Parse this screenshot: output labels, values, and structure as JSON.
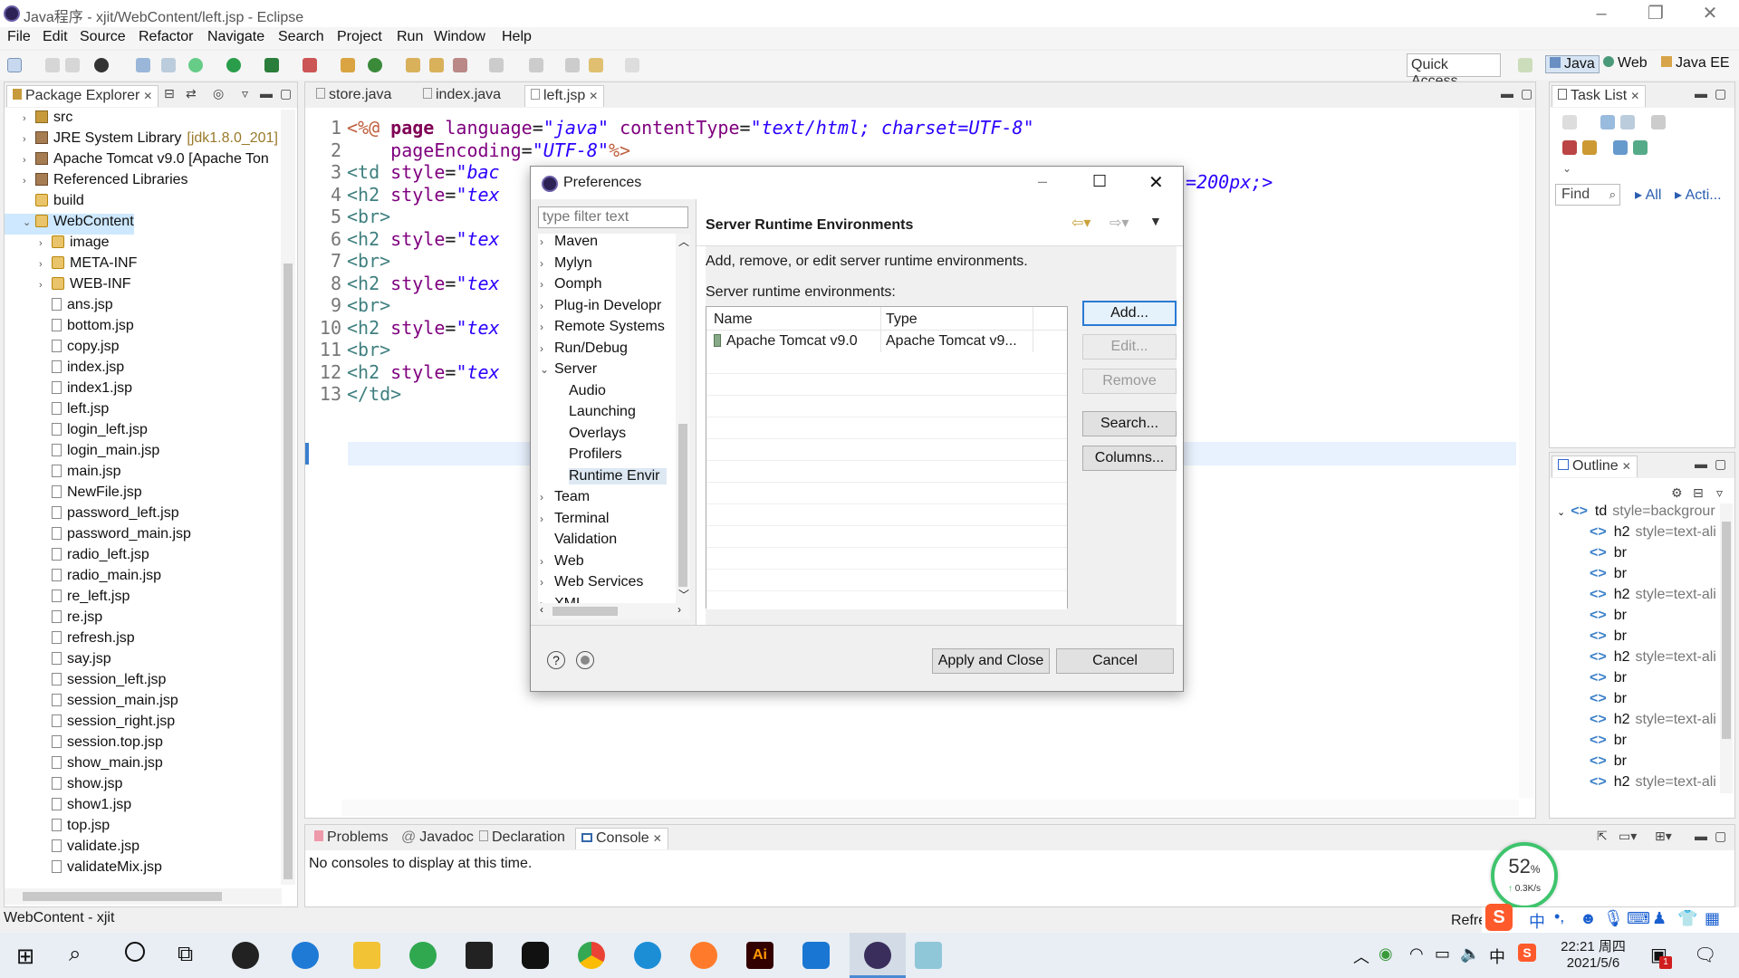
{
  "window": {
    "title": "Java程序 - xjit/WebContent/left.jsp - Eclipse"
  },
  "menu": [
    "File",
    "Edit",
    "Source",
    "Refactor",
    "Navigate",
    "Search",
    "Project",
    "Run",
    "Window",
    "Help"
  ],
  "toolbar": {
    "quick_access": "Quick Access",
    "perspectives": [
      "Java",
      "Web",
      "Java EE"
    ]
  },
  "explorer": {
    "tab": "Package Explorer",
    "items": [
      {
        "label": "src",
        "type": "pkg",
        "indent": 1,
        "arrow": "›"
      },
      {
        "label": "JRE System Library",
        "extra": "[jdk1.8.0_201]",
        "type": "lib",
        "indent": 1,
        "arrow": "›"
      },
      {
        "label": "Apache Tomcat v9.0 [Apache Ton",
        "type": "lib",
        "indent": 1,
        "arrow": "›"
      },
      {
        "label": "Referenced Libraries",
        "type": "lib",
        "indent": 1,
        "arrow": "›"
      },
      {
        "label": "build",
        "type": "folder",
        "indent": 1,
        "arrow": ""
      },
      {
        "label": "WebContent",
        "type": "folder",
        "indent": 1,
        "arrow": "⌄",
        "selected": true
      },
      {
        "label": "image",
        "type": "folder",
        "indent": 2,
        "arrow": "›"
      },
      {
        "label": "META-INF",
        "type": "folder",
        "indent": 2,
        "arrow": "›"
      },
      {
        "label": "WEB-INF",
        "type": "folder",
        "indent": 2,
        "arrow": "›"
      },
      {
        "label": "ans.jsp",
        "type": "file",
        "indent": 2
      },
      {
        "label": "bottom.jsp",
        "type": "file",
        "indent": 2
      },
      {
        "label": "copy.jsp",
        "type": "file",
        "indent": 2
      },
      {
        "label": "index.jsp",
        "type": "file",
        "indent": 2
      },
      {
        "label": "index1.jsp",
        "type": "file",
        "indent": 2
      },
      {
        "label": "left.jsp",
        "type": "file",
        "indent": 2
      },
      {
        "label": "login_left.jsp",
        "type": "file",
        "indent": 2
      },
      {
        "label": "login_main.jsp",
        "type": "file",
        "indent": 2
      },
      {
        "label": "main.jsp",
        "type": "file",
        "indent": 2
      },
      {
        "label": "NewFile.jsp",
        "type": "file",
        "indent": 2
      },
      {
        "label": "password_left.jsp",
        "type": "file",
        "indent": 2
      },
      {
        "label": "password_main.jsp",
        "type": "file",
        "indent": 2
      },
      {
        "label": "radio_left.jsp",
        "type": "file",
        "indent": 2
      },
      {
        "label": "radio_main.jsp",
        "type": "file",
        "indent": 2
      },
      {
        "label": "re_left.jsp",
        "type": "file",
        "indent": 2
      },
      {
        "label": "re.jsp",
        "type": "file",
        "indent": 2
      },
      {
        "label": "refresh.jsp",
        "type": "file",
        "indent": 2
      },
      {
        "label": "say.jsp",
        "type": "file",
        "indent": 2
      },
      {
        "label": "session_left.jsp",
        "type": "file",
        "indent": 2
      },
      {
        "label": "session_main.jsp",
        "type": "file",
        "indent": 2
      },
      {
        "label": "session_right.jsp",
        "type": "file",
        "indent": 2
      },
      {
        "label": "session.top.jsp",
        "type": "file",
        "indent": 2
      },
      {
        "label": "show_main.jsp",
        "type": "file",
        "indent": 2
      },
      {
        "label": "show.jsp",
        "type": "file",
        "indent": 2
      },
      {
        "label": "show1.jsp",
        "type": "file",
        "indent": 2
      },
      {
        "label": "top.jsp",
        "type": "file",
        "indent": 2
      },
      {
        "label": "validate.jsp",
        "type": "file",
        "indent": 2
      },
      {
        "label": "validateMix.jsp",
        "type": "file",
        "indent": 2
      }
    ]
  },
  "editor": {
    "tabs": [
      "store.java",
      "index.java",
      "left.jsp"
    ],
    "active_tab": "left.jsp",
    "lines": [
      {
        "n": "1",
        "html": "<span class='jsp'>&lt;%@</span> <span class='kw'>page</span> <span class='attr'>language</span>=<span class='str'>\"java\"</span> <span class='attr'>contentType</span>=<span class='str'>\"text/html; charset=UTF-8\"</span>"
      },
      {
        "n": "2",
        "html": "    <span class='attr'>pageEncoding</span>=<span class='str'>\"UTF-8\"</span><span class='jsp'>%&gt;</span>"
      },
      {
        "n": "3",
        "html": "<span class='tag'>&lt;td</span> <span class='attr'>style</span>=<span class='str'>\"bac</span>"
      },
      {
        "n": "4",
        "html": "<span class='tag'>&lt;h2</span> <span class='attr'>style</span>=<span class='str'>\"tex</span>"
      },
      {
        "n": "5",
        "html": "<span class='tag'>&lt;br&gt;</span>"
      },
      {
        "n": "6",
        "html": "<span class='tag'>&lt;h2</span> <span class='attr'>style</span>=<span class='str'>\"tex</span>"
      },
      {
        "n": "7",
        "html": "<span class='tag'>&lt;br&gt;</span>"
      },
      {
        "n": "8",
        "html": "<span class='tag'>&lt;h2</span> <span class='attr'>style</span>=<span class='str'>\"tex</span>"
      },
      {
        "n": "9",
        "html": "<span class='tag'>&lt;br&gt;</span>"
      },
      {
        "n": "10",
        "html": "<span class='tag'>&lt;h2</span> <span class='attr'>style</span>=<span class='str'>\"tex</span>"
      },
      {
        "n": "11",
        "html": "<span class='tag'>&lt;br&gt;</span>"
      },
      {
        "n": "12",
        "html": "<span class='tag'>&lt;h2</span> <span class='attr'>style</span>=<span class='str'>\"tex</span>"
      },
      {
        "n": "13",
        "html": "<span class='tag'>&lt;/td&gt;</span>"
      }
    ],
    "line3_tail": "=200px;>"
  },
  "tasklist": {
    "tab": "Task List",
    "find_placeholder": "Find",
    "all": "All",
    "acti": "Acti..."
  },
  "outline": {
    "tab": "Outline",
    "items": [
      {
        "label": "td",
        "extra": "style=backgrour",
        "root": true
      },
      {
        "label": "h2",
        "extra": "style=text-ali"
      },
      {
        "label": "br"
      },
      {
        "label": "br"
      },
      {
        "label": "h2",
        "extra": "style=text-ali"
      },
      {
        "label": "br"
      },
      {
        "label": "br"
      },
      {
        "label": "h2",
        "extra": "style=text-ali"
      },
      {
        "label": "br"
      },
      {
        "label": "br"
      },
      {
        "label": "h2",
        "extra": "style=text-ali"
      },
      {
        "label": "br"
      },
      {
        "label": "br"
      },
      {
        "label": "h2",
        "extra": "style=text-ali"
      }
    ]
  },
  "console": {
    "tabs": [
      "Problems",
      "Javadoc",
      "Declaration",
      "Console"
    ],
    "active_tab": "Console",
    "message": "No consoles to display at this time."
  },
  "status": {
    "left": "WebContent - xjit",
    "refresh": "Refre"
  },
  "net_widget": {
    "percent": "52",
    "unit": "%",
    "speed": "0.3K/s"
  },
  "dialog": {
    "title": "Preferences",
    "filter_placeholder": "type filter text",
    "tree": [
      {
        "label": "Maven",
        "arrow": "›",
        "indent": 0
      },
      {
        "label": "Mylyn",
        "arrow": "›",
        "indent": 0
      },
      {
        "label": "Oomph",
        "arrow": "›",
        "indent": 0
      },
      {
        "label": "Plug-in Developr",
        "arrow": "›",
        "indent": 0
      },
      {
        "label": "Remote Systems",
        "arrow": "›",
        "indent": 0
      },
      {
        "label": "Run/Debug",
        "arrow": "›",
        "indent": 0
      },
      {
        "label": "Server",
        "arrow": "⌄",
        "indent": 0
      },
      {
        "label": "Audio",
        "indent": 1
      },
      {
        "label": "Launching",
        "indent": 1
      },
      {
        "label": "Overlays",
        "indent": 1
      },
      {
        "label": "Profilers",
        "indent": 1
      },
      {
        "label": "Runtime Envir",
        "indent": 1,
        "selected": true
      },
      {
        "label": "Team",
        "arrow": "›",
        "indent": 0
      },
      {
        "label": "Terminal",
        "arrow": "›",
        "indent": 0
      },
      {
        "label": "Validation",
        "indent": 0
      },
      {
        "label": "Web",
        "arrow": "›",
        "indent": 0
      },
      {
        "label": "Web Services",
        "arrow": "›",
        "indent": 0
      },
      {
        "label": "XML",
        "arrow": "›",
        "indent": 0
      }
    ],
    "page_title": "Server Runtime Environments",
    "description": "Add, remove, or edit server runtime environments.",
    "list_label": "Server runtime environments:",
    "columns": [
      "Name",
      "Type"
    ],
    "rows": [
      {
        "name": "Apache Tomcat v9.0",
        "type": "Apache Tomcat v9..."
      }
    ],
    "buttons": {
      "add": "Add...",
      "edit": "Edit...",
      "remove": "Remove",
      "search": "Search...",
      "columns": "Columns..."
    },
    "apply_close": "Apply and Close",
    "cancel": "Cancel"
  },
  "taskbar": {
    "time": "22:21 周四",
    "date": "2021/5/6",
    "ime": "中",
    "notif_count": "1"
  },
  "colors": {
    "selection": "#cde8ff",
    "accent": "#2a7bd4",
    "net_green": "#3ec46d"
  }
}
